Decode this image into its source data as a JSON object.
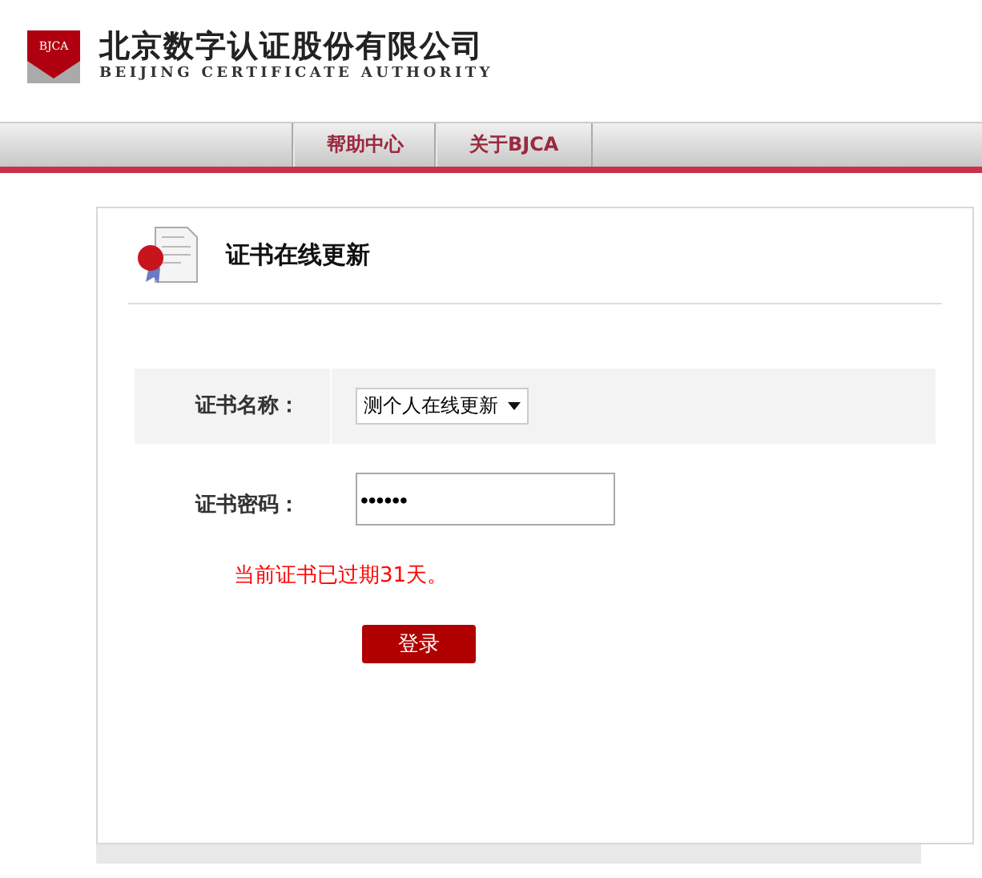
{
  "logo": {
    "badge": "BJCA",
    "name": "北京数字认证股份有限公司",
    "subtitle": "BEIJING CERTIFICATE AUTHORITY"
  },
  "nav": [
    {
      "label": "帮助中心"
    },
    {
      "label": "关于BJCA"
    }
  ],
  "panel": {
    "title": "证书在线更新",
    "fields": [
      {
        "kind": "select",
        "label": "证书名称：",
        "value": "测个人在线更新"
      },
      {
        "kind": "password",
        "label": "证书密码：",
        "value": "••••••"
      }
    ],
    "error": "当前证书已过期31天。",
    "button": "登录"
  }
}
